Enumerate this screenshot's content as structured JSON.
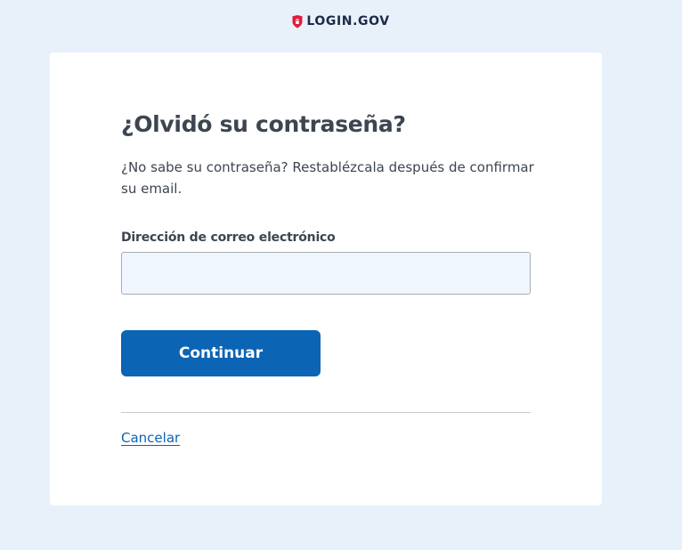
{
  "header": {
    "logo_text": "LOGIN.GOV",
    "logo_icon": "shield-icon"
  },
  "form": {
    "title": "¿Olvidó su contraseña?",
    "description": "¿No sabe su contraseña? Restablézcala después de confirmar su email.",
    "email_label": "Dirección de correo electrónico",
    "email_value": "",
    "email_placeholder": "",
    "continue_label": "Continuar",
    "cancel_label": "Cancelar"
  },
  "colors": {
    "page_background": "#e8f1fa",
    "card_background": "#ffffff",
    "primary": "#0b64b4",
    "input_background": "#eff6fd",
    "text": "#3d4551",
    "logo_red": "#e21c3d",
    "logo_navy": "#1b2a48"
  }
}
